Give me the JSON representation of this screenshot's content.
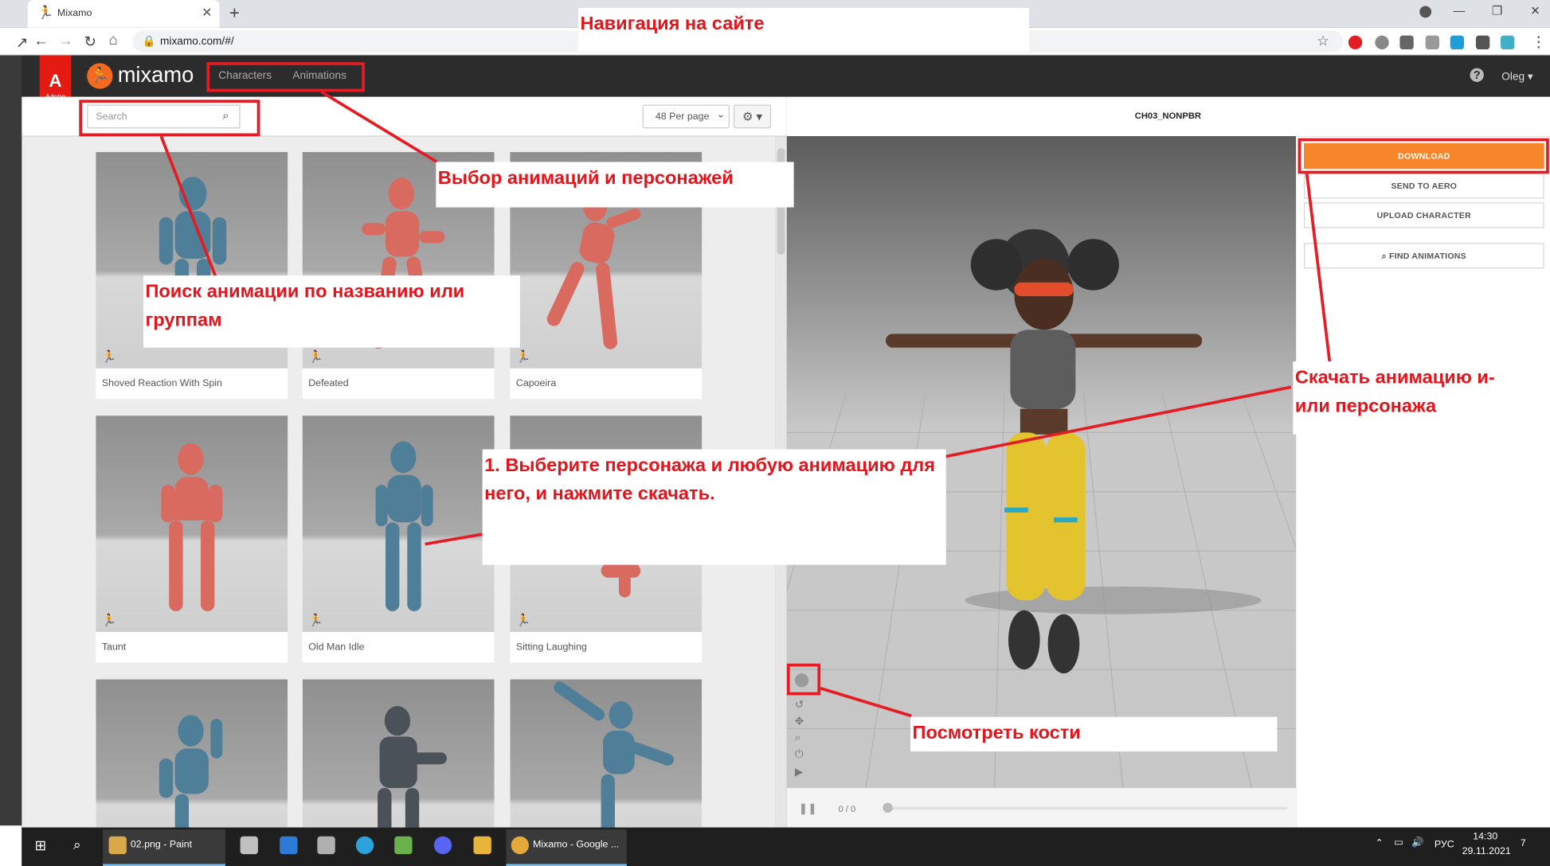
{
  "browser": {
    "tab_title": "Mixamo",
    "url": "mixamo.com/#/"
  },
  "app": {
    "logo": "mixamo",
    "adobe": "A",
    "adobe_sub": "Adobe",
    "nav": [
      "Characters",
      "Animations"
    ],
    "user": "Oleg",
    "help": "?"
  },
  "search": {
    "placeholder": "Search"
  },
  "per_page": "48 Per page",
  "animations": [
    "Shoved Reaction With Spin",
    "Defeated",
    "Capoeira",
    "Taunt",
    "Old Man Idle",
    "Sitting Laughing"
  ],
  "character_name": "CH03_NONPBR",
  "actions": {
    "download": "DOWNLOAD",
    "send": "SEND TO AERO",
    "upload": "UPLOAD CHARACTER",
    "find": "FIND ANIMATIONS"
  },
  "player": {
    "frames": "0 / 0"
  },
  "annotations": {
    "nav": "Навигация на сайте",
    "select": "Выбор анимаций и персонажей",
    "search": "Поиск анимации по названию или группам",
    "download": "Скачать анимацию и-или персонажа",
    "steps": "1. Выберите персонажа и любую анимацию для него, и нажмите скачать.",
    "bones": "Посмотреть кости"
  },
  "taskbar": {
    "paint": "02.png - Paint",
    "chrome": "Mixamo - Google ...",
    "lang": "РУС",
    "time": "14:30",
    "date": "29.11.2021",
    "notif": "7"
  }
}
